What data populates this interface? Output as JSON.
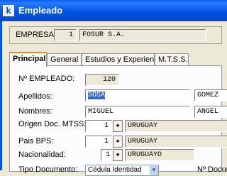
{
  "window": {
    "title": "Empleado",
    "icon": "k"
  },
  "empresa": {
    "label": "EMPRESA:",
    "code": "1",
    "name": "FOSUR S.A."
  },
  "tabs": [
    "Principal",
    "General",
    "Estudios y Experiencia",
    "M.T.S.S."
  ],
  "form": {
    "numero_label": "Nº EMPLEADO:",
    "numero_value": "120",
    "apellidos_label": "Apellidos:",
    "apellido1": "SOSA",
    "apellido2": "GOMEZ",
    "nombres_label": "Nombres:",
    "nombre1": "MIGUEL",
    "nombre2": "ANGEL",
    "origen_label": "Origen Doc. MTSS:",
    "origen_code": "1",
    "origen_value": "URUGUAY",
    "pais_bps_label": "Pais BPS:",
    "pais_bps_code": "1",
    "pais_bps_value": "URUGUAY",
    "nacionalidad_label": "Nacionalidad:",
    "nacionalidad_code": "1",
    "nacionalidad_value": "URUGUAYO",
    "tipo_doc_label": "Tipo Documento:",
    "tipo_doc_value": "Cédula Identidad",
    "numero_doc_label": "Nº Docum"
  },
  "icons": {
    "lookup": "✦",
    "dropdown": "▼"
  }
}
